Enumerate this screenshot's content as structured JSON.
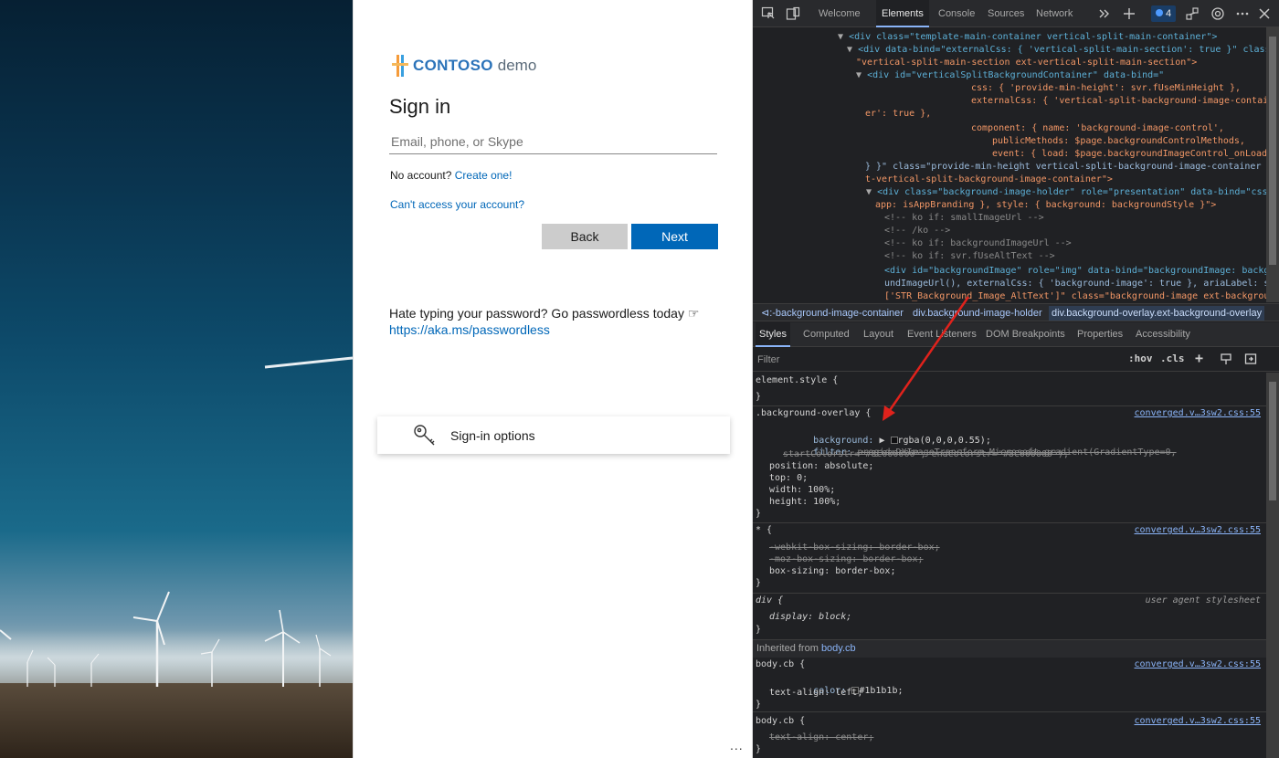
{
  "signin": {
    "brand": "CONTOSO",
    "brand_suffix": "demo",
    "title": "Sign in",
    "email_placeholder": "Email, phone, or Skype",
    "no_account_text": "No account?",
    "create_link": "Create one!",
    "cant_access_link": "Can't access your account?",
    "back_label": "Back",
    "next_label": "Next",
    "passwordless_text": "Hate typing your password? Go passwordless today ☞",
    "passwordless_link": "https://aka.ms/passwordless",
    "options_label": "Sign-in options",
    "more_label": "...",
    "accent_color": "#0067b8"
  },
  "devtools": {
    "tabs": [
      "Welcome",
      "Elements",
      "Console",
      "Sources",
      "Network"
    ],
    "active_tab": "Elements",
    "issues_count": "4",
    "breadcrumbs": [
      "⊲:-background-image-container",
      "div.background-image-holder",
      "div.background-overlay.ext-background-overlay"
    ],
    "subtabs": [
      "Styles",
      "Computed",
      "Layout",
      "Event Listeners",
      "DOM Breakpoints",
      "Properties",
      "Accessibility"
    ],
    "active_subtab": "Styles",
    "filter_placeholder": "Filter",
    "hov_label": ":hov",
    "cls_label": ".cls",
    "element_style": "element.style {",
    "overlay_selector": ".background-overlay {",
    "overlay_background_prop": "background:",
    "overlay_background_val": "rgba(0,0,0,0.55);",
    "overlay_filter_prop": "filter:",
    "overlay_filter_val": "progid:DXImageTransform.Microsoft.gradient(GradientType=0,",
    "overlay_filter_val2": "startColorstr='#8C000000', endColorstr='#8C000000');",
    "overlay_position": "position: absolute;",
    "overlay_top": "top: 0;",
    "overlay_width": "width: 100%;",
    "overlay_height": "height: 100%;",
    "universal_selector": "* {",
    "webkit_box": "-webkit-box-sizing: border-box;",
    "moz_box": "-moz-box-sizing: border-box;",
    "box_sizing": "box-sizing: border-box;",
    "div_selector": "div {",
    "div_display": "display: block;",
    "user_agent": "user agent stylesheet",
    "inherited_from": "Inherited from",
    "inherited_link": "body.cb",
    "body_cb_1": "body.cb {",
    "body_color": "color:",
    "body_color_val": "#1b1b1b;",
    "body_text_align": "text-align: left;",
    "body_cb_2": "body.cb {",
    "body_text_align_center": "text-align: center;",
    "source_link": "converged.v…3sw2.css:55",
    "close_brace": "}",
    "dom_lines": [
      "<div class=\"template-main-container vertical-split-main-container\">",
      "<div data-bind=\"externalCss: { 'vertical-split-main-section': true }\" class=",
      "\"vertical-split-main-section ext-vertical-split-main-section\">",
      "<div id=\"verticalSplitBackgroundContainer\" data-bind=\"",
      "css: { 'provide-min-height': svr.fUseMinHeight },",
      "externalCss: { 'vertical-split-background-image-contain",
      "er': true },",
      "component: { name: 'background-image-control',",
      "publicMethods: $page.backgroundControlMethods,",
      "event: { load: $page.backgroundImageControl_onLoad",
      "} }\" class=\"provide-min-height vertical-split-background-image-container ex",
      "t-vertical-split-background-image-container\">",
      "<div class=\"background-image-holder\" role=\"presentation\" data-bind=\"css: {",
      "app: isAppBranding }, style: { background: backgroundStyle }\">",
      "<!-- ko if: smallImageUrl -->",
      "<!-- /ko -->",
      "<!-- ko if: backgroundImageUrl -->",
      "<!-- ko if: svr.fUseAltText -->",
      "<div id=\"backgroundImage\" role=\"img\" data-bind=\"backgroundImage: backgro",
      "undImageUrl(), externalCss: { 'background-image': true }, ariaLabel: str",
      "['STR_Background_Image_AltText']\" class=\"background-image ext-background"
    ]
  }
}
